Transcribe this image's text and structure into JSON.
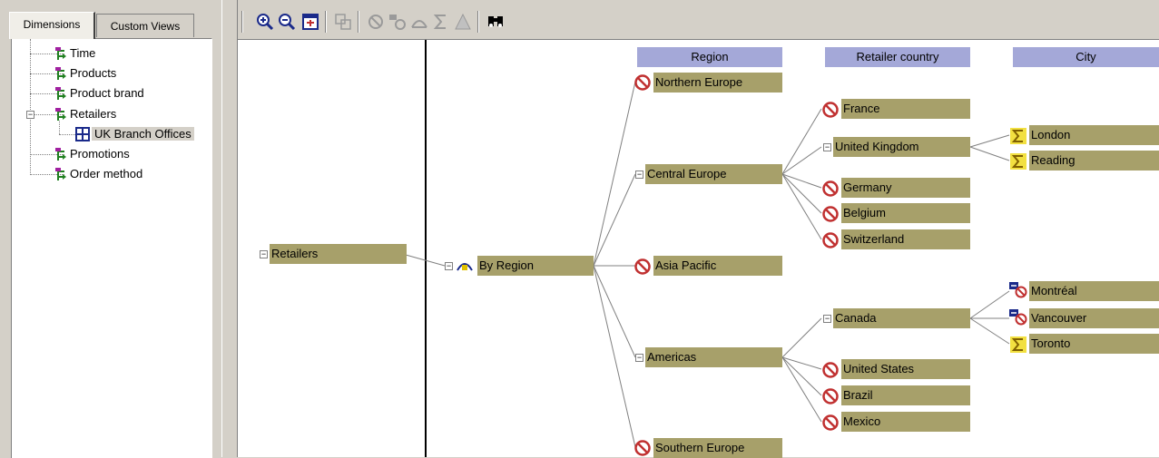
{
  "tabs": {
    "dimensions": "Dimensions",
    "custom_views": "Custom Views"
  },
  "tree": {
    "time": "Time",
    "products": "Products",
    "product_brand": "Product brand",
    "retailers": "Retailers",
    "uk_branch_offices": "UK Branch Offices",
    "promotions": "Promotions",
    "order_method": "Order method"
  },
  "toolbar": {
    "icons": [
      "zoom-in-icon",
      "zoom-out-icon",
      "fit-to-window-icon",
      "copy-icon",
      "exclude-icon",
      "substitute-icon",
      "drill-icon",
      "sum-icon",
      "triangle-icon",
      "find-icon"
    ]
  },
  "headers": {
    "region": "Region",
    "retailer_country": "Retailer country",
    "city": "City"
  },
  "nodes": {
    "retailers": "Retailers",
    "by_region": "By Region",
    "northern_europe": "Northern Europe",
    "central_europe": "Central Europe",
    "asia_pacific": "Asia Pacific",
    "americas": "Americas",
    "southern_europe": "Southern Europe",
    "france": "France",
    "united_kingdom": "United Kingdom",
    "germany": "Germany",
    "belgium": "Belgium",
    "switzerland": "Switzerland",
    "canada": "Canada",
    "united_states": "United States",
    "brazil": "Brazil",
    "mexico": "Mexico",
    "london": "London",
    "reading": "Reading",
    "montreal": "Montréal",
    "vancouver": "Vancouver",
    "toronto": "Toronto"
  },
  "colors": {
    "node": "#a7a06a",
    "header": "#a4a8d8",
    "exclude": "#c03030",
    "sum": "#e0c000"
  }
}
